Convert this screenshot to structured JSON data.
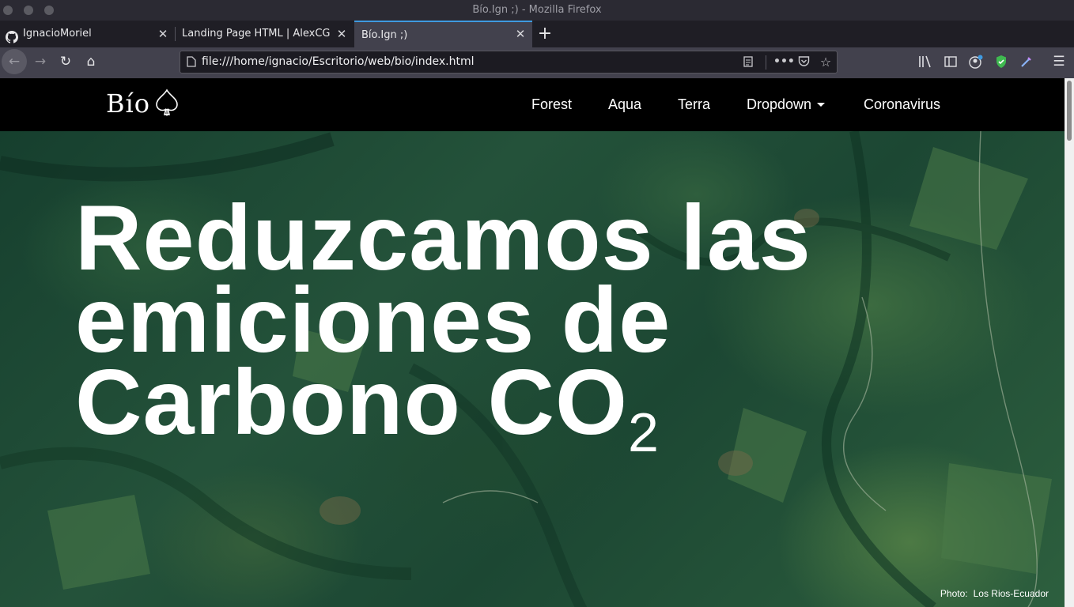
{
  "window": {
    "title": "Bío.Ign ;) - Mozilla Firefox"
  },
  "tabs": [
    {
      "label": "IgnacioMoriel",
      "icon": "github-icon",
      "active": false
    },
    {
      "label": "Landing Page HTML | AlexCG",
      "active": false
    },
    {
      "label": "Bío.Ign ;)",
      "active": true
    }
  ],
  "browser": {
    "url": "file:///home/ignacio/Escritorio/web/bio/index.html",
    "accent": "#3f9ae0",
    "toolbar_icons": [
      "back-icon",
      "forward-icon",
      "reload-icon",
      "home-icon",
      "reader-view-icon",
      "more-icon",
      "pocket-icon",
      "bookmark-star-icon",
      "library-icon",
      "sidebar-icon",
      "account-icon",
      "shield-extension-icon",
      "eyedropper-extension-icon",
      "menu-icon"
    ]
  },
  "site": {
    "logo": "Bío",
    "nav": {
      "forest": "Forest",
      "aqua": "Aqua",
      "terra": "Terra",
      "dropdown": "Dropdown",
      "coronavirus": "Coronavirus"
    },
    "hero": {
      "line1": "Reduzcamos las",
      "line2": "emiciones de",
      "line3": "Carbono CO",
      "subscript": "2",
      "photo_label": "Photo:",
      "photo_credit": "Los Rios-Ecuador"
    }
  }
}
